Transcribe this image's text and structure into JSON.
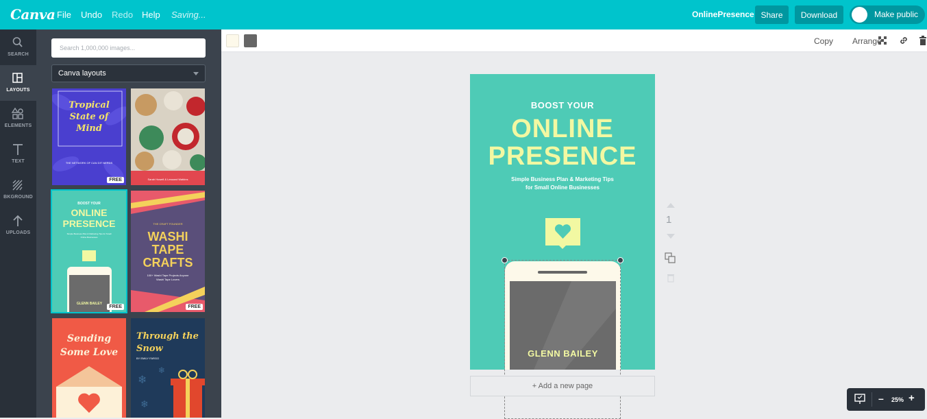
{
  "app": {
    "logo": "Canva",
    "menu": [
      "File",
      "Undo",
      "Redo",
      "Help"
    ],
    "status": "Saving...",
    "doc_title": "OnlinePresence",
    "share_label": "Share",
    "download_label": "Download",
    "make_public_label": "Make public"
  },
  "rail": {
    "items": [
      {
        "label": "SEARCH",
        "icon": "search-icon"
      },
      {
        "label": "LAYOUTS",
        "icon": "layouts-icon"
      },
      {
        "label": "ELEMENTS",
        "icon": "elements-icon"
      },
      {
        "label": "TEXT",
        "icon": "text-icon"
      },
      {
        "label": "BKGROUND",
        "icon": "background-icon"
      },
      {
        "label": "UPLOADS",
        "icon": "upload-icon"
      }
    ],
    "active": "LAYOUTS"
  },
  "panel": {
    "search_placeholder": "Search 1,000,000 images...",
    "dropdown_value": "Canva layouts",
    "free_badge": "FREE",
    "thumbs": {
      "t1_title": "Tropical State of Mind",
      "t1_sub": "THE NETWORK OF CAN DIT NERDS",
      "t2_sub": "Sarah Howell & Lessand Watkins",
      "t3_boost": "BOOST YOUR",
      "t3_online": "ONLINE",
      "t3_presence": "PRESENCE",
      "t3_sub": "Simple Business Plan & Marketing Tips for Small Online Businesses",
      "t3_name": "GLENN BAILEY",
      "t4_top": "THE CRAFT FOUNDER",
      "t4_washi": "WASHI",
      "t4_tape": "TAPE",
      "t4_crafts": "CRAFTS",
      "t4_sub": "100+ Washi Tape Projects Anyone Washi Tape Lovers",
      "t5_title": "Sending Some Love",
      "t6_title": "Through the Snow",
      "t6_sub": "BY EMILY FARGO"
    }
  },
  "toolbar": {
    "swatches": [
      "#fdf9ea",
      "#666666"
    ],
    "copy_label": "Copy",
    "arrange_label": "Arrange"
  },
  "design": {
    "boost": "BOOST YOUR",
    "online": "ONLINE",
    "presence": "PRESENCE",
    "sub_line1": "Simple Business Plan & Marketing Tips",
    "sub_line2": "for Small Online Businesses",
    "name": "GLENN BAILEY",
    "bg_color": "#4ecbb6",
    "accent_color": "#f2f8a2"
  },
  "canvas": {
    "add_page_label": "+ Add a new page",
    "page_number": "1",
    "zoom_value": "25%",
    "zoom_minus": "–",
    "zoom_plus": "+"
  }
}
